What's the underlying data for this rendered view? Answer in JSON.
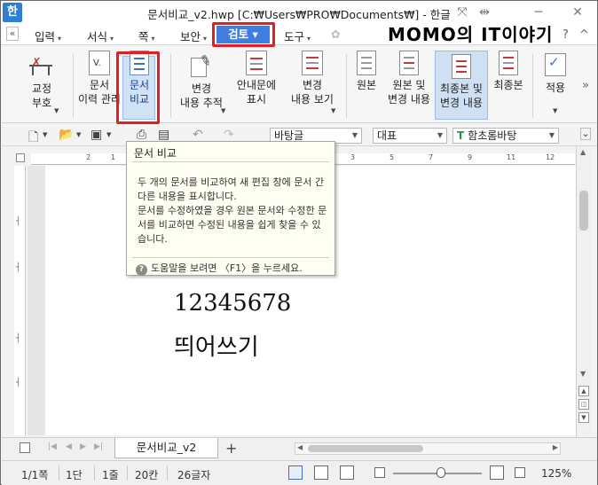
{
  "window": {
    "app_icon": "한",
    "title": "문서비교_v2.hwp [C:₩Users₩PRO₩Documents₩] - 한글",
    "controls": [
      "pin-icon",
      "fit-icon",
      "minimize-icon",
      "close-icon"
    ]
  },
  "menubar": {
    "collapse": "«",
    "items": [
      {
        "label": "입력",
        "caret": "▾"
      },
      {
        "label": "서식",
        "caret": "▾"
      },
      {
        "label": "쪽",
        "caret": "▾"
      },
      {
        "label": "보안",
        "caret": "▾"
      },
      {
        "label": "검토",
        "caret": "▾"
      },
      {
        "label": "도구",
        "caret": "▾"
      }
    ],
    "active": "검토 ▾",
    "blog_title": "MOMO의 IT이야기",
    "help_question": "?",
    "help_caret": "^"
  },
  "ribbon": {
    "buttons": [
      {
        "label": "교정\n부호",
        "has_caret": true
      },
      {
        "label": "문서\n이력 관리",
        "has_caret": false
      },
      {
        "label": "문서\n비교",
        "has_caret": false,
        "highlighted": true
      },
      {
        "label": "변경\n내용 추적",
        "has_caret": true
      },
      {
        "label": "안내문에\n표시",
        "has_caret": false
      },
      {
        "label": "변경\n내용 보기",
        "has_caret": true
      },
      {
        "label": "원본",
        "has_caret": false
      },
      {
        "label": "원본 및\n변경 내용",
        "has_caret": false
      },
      {
        "label": "최종본 및\n변경 내용",
        "has_caret": false,
        "selected": true
      },
      {
        "label": "최종본",
        "has_caret": false
      },
      {
        "label": "적용",
        "has_caret": true
      }
    ],
    "overflow": "»"
  },
  "toolbar2": {
    "style_box": "바탕글",
    "para_box": "대표",
    "font_box": "함초롬바탕",
    "font_prefix": "T"
  },
  "ruler": {
    "numbers": [
      "2",
      "1",
      "1",
      "2",
      "3",
      "4",
      "5",
      "6",
      "7",
      "8",
      "9",
      "10",
      "11",
      "12"
    ]
  },
  "tooltip": {
    "title": "문서 비교",
    "body": "두 개의 문서를 비교하여 새 편집 창에 문서 간 다른 내용을 표시합니다.\n문서를 수정하였을 경우 원본 문서와 수정한 문서를 비교하면 수정된 내용을 쉽게 찾을 수 있습니다.",
    "help_icon": "?",
    "help_text": "도움말을 보려면 〈F1〉을 누르세요."
  },
  "document": {
    "lines": [
      "12345678",
      "띄어쓰기"
    ]
  },
  "tabs": {
    "doc_tab": "문서비교_v2",
    "add": "+"
  },
  "status": {
    "page": "1/1쪽",
    "section": "1단",
    "line": "1줄",
    "column": "20칸",
    "chars": "26글자",
    "zoom": "125%"
  }
}
